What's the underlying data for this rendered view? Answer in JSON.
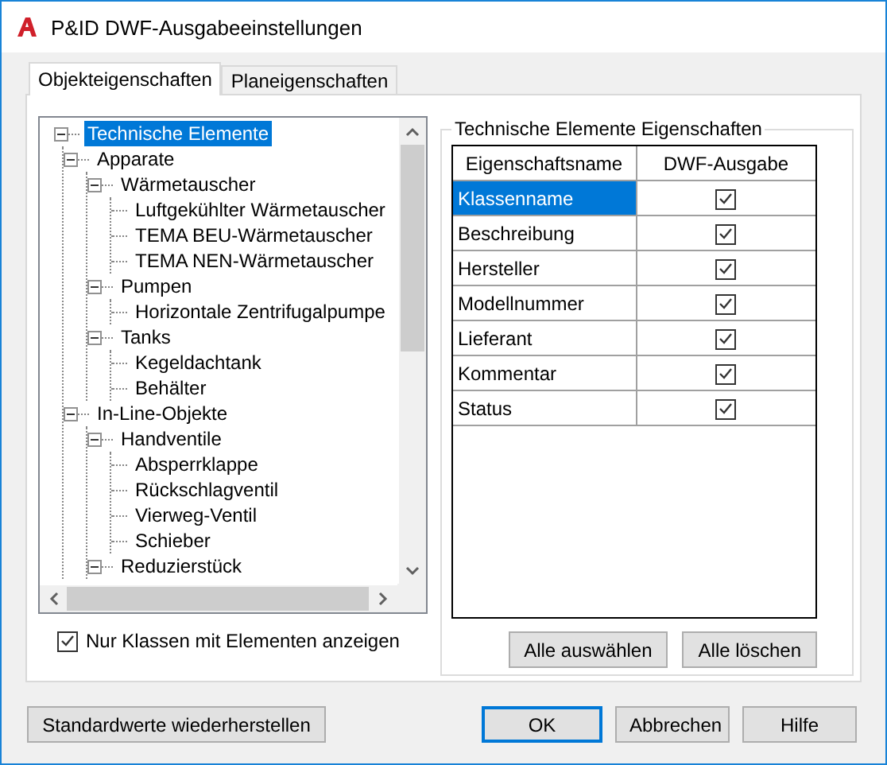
{
  "window": {
    "title": "P&ID DWF-Ausgabeeinstellungen"
  },
  "tabs": [
    {
      "label": "Objekteigenschaften",
      "selected": true
    },
    {
      "label": "Planeigenschaften",
      "selected": false
    }
  ],
  "tree": {
    "items": [
      {
        "label": "Technische Elemente",
        "selected": true,
        "expanded": true,
        "children": [
          {
            "label": "Apparate",
            "selected": false,
            "expanded": true,
            "children": [
              {
                "label": "Wärmetauscher",
                "selected": false,
                "expanded": true,
                "children": [
                  {
                    "label": "Luftgekühlter Wärmetauscher",
                    "selected": false
                  },
                  {
                    "label": "TEMA BEU-Wärmetauscher",
                    "selected": false
                  },
                  {
                    "label": "TEMA NEN-Wärmetauscher",
                    "selected": false
                  }
                ]
              },
              {
                "label": "Pumpen",
                "selected": false,
                "expanded": true,
                "children": [
                  {
                    "label": "Horizontale Zentrifugalpumpe",
                    "selected": false
                  }
                ]
              },
              {
                "label": "Tanks",
                "selected": false,
                "expanded": true,
                "children": [
                  {
                    "label": "Kegeldachtank",
                    "selected": false
                  },
                  {
                    "label": "Behälter",
                    "selected": false
                  }
                ]
              }
            ]
          },
          {
            "label": "In-Line-Objekte",
            "selected": false,
            "expanded": true,
            "children": [
              {
                "label": "Handventile",
                "selected": false,
                "expanded": true,
                "children": [
                  {
                    "label": "Absperrklappe",
                    "selected": false
                  },
                  {
                    "label": "Rückschlagventil",
                    "selected": false
                  },
                  {
                    "label": "Vierweg-Ventil",
                    "selected": false
                  },
                  {
                    "label": "Schieber",
                    "selected": false
                  }
                ]
              },
              {
                "label": "Reduzierstück",
                "selected": false,
                "expanded": true
              }
            ]
          }
        ]
      }
    ]
  },
  "filter_checkbox": {
    "label": "Nur Klassen mit Elementen anzeigen",
    "checked": true
  },
  "properties": {
    "title": "Technische Elemente Eigenschaften",
    "columns": [
      "Eigenschaftsname",
      "DWF-Ausgabe"
    ],
    "rows": [
      {
        "name": "Klassenname",
        "dwf_output": true,
        "selected": true
      },
      {
        "name": "Beschreibung",
        "dwf_output": true,
        "selected": false
      },
      {
        "name": "Hersteller",
        "dwf_output": true,
        "selected": false
      },
      {
        "name": "Modellnummer",
        "dwf_output": true,
        "selected": false
      },
      {
        "name": "Lieferant",
        "dwf_output": true,
        "selected": false
      },
      {
        "name": "Kommentar",
        "dwf_output": true,
        "selected": false
      },
      {
        "name": "Status",
        "dwf_output": true,
        "selected": false
      }
    ],
    "buttons": [
      "Alle auswählen",
      "Alle löschen"
    ]
  },
  "footer": {
    "reset_button": "Standardwerte wiederherstellen",
    "buttons": [
      {
        "label": "OK",
        "default": true
      },
      {
        "label": "Abbrechen",
        "default": false
      },
      {
        "label": "Hilfe",
        "default": false
      }
    ]
  }
}
